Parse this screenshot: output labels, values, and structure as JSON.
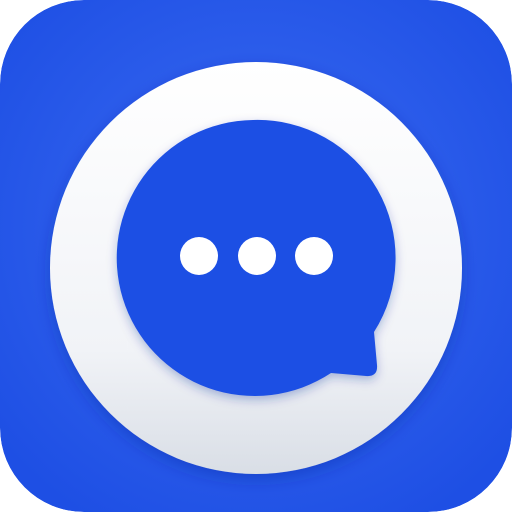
{
  "app_icon": {
    "icon": "chat-bubble-icon",
    "colors": {
      "background": "#1E4FE4",
      "background_glow": "#3A6BF2",
      "ring": "#FFFFFF",
      "ring_shade": "#D9DEE6",
      "bubble": "#1E4FE4",
      "dots": "#FFFFFF"
    }
  }
}
